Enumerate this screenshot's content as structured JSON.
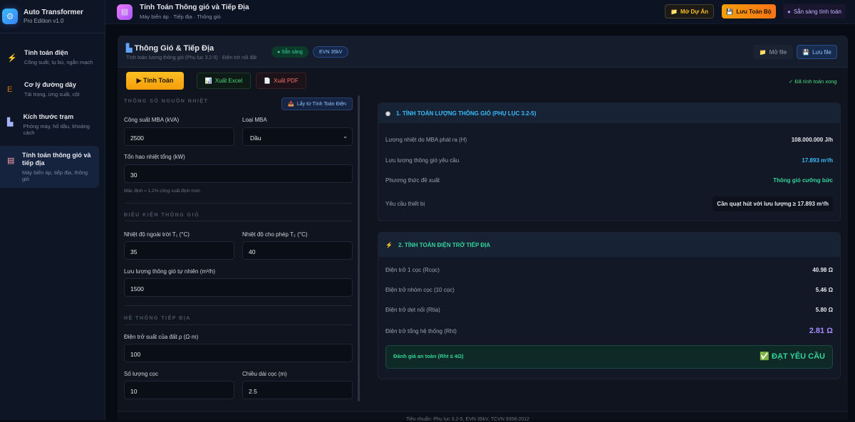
{
  "app": {
    "name": "Auto Transformer",
    "edition": "Pro Edition v1.0"
  },
  "sidebar": {
    "items": [
      {
        "title": "Tính toán điện",
        "sub": "Công suất, tụ bù, ngắn mạch",
        "icon": "lightning-icon"
      },
      {
        "title": "Cơ lý đường dây",
        "sub": "Tải trọng, ứng suất, cột",
        "icon": "tower-icon"
      },
      {
        "title": "Kích thước trạm",
        "sub": "Phòng máy, hố dầu, khoảng cách",
        "icon": "factory-icon"
      },
      {
        "title": "Tính toán thông gió và tiếp địa",
        "sub": "Máy biến áp, tiếp địa, thông gió",
        "icon": "clipboard-icon"
      }
    ]
  },
  "topbar": {
    "title": "Tính Toán Thông gió và Tiếp Địa",
    "sub": "Máy biến áp · Tiếp địa · Thông gió",
    "open_project": "Mở Dự Án",
    "save_all": "Lưu Toàn Bộ",
    "status": "Sẵn sàng tính toán"
  },
  "panel": {
    "title": "Thông Gió & Tiếp Địa",
    "sub": "Tính toán lượng thông gió (Phụ lục 3.2-5) · Điện trở nối đất",
    "badge_ready": "● Sẵn sàng",
    "badge_evn": "EVN 35kV",
    "open_file": "Mở file",
    "save_file": "Lưu file"
  },
  "toolbar": {
    "calc": "▶ Tính Toán",
    "excel": "Xuất Excel",
    "pdf": "Xuất PDF",
    "done": "✓ Đã tính toán xong"
  },
  "form": {
    "sec_heat": "THÔNG SỐ NGUỒN NHIỆT",
    "fetch": "Lấy từ Tính Toán Điện",
    "power_label": "Công suất MBA (kVA)",
    "power": "2500",
    "type_label": "Loại MBA",
    "type": "Dầu",
    "loss_label": "Tổn hao nhiệt tổng (kW)",
    "loss": "30",
    "loss_hint": "Mặc định ≈ 1.2% công suất định mức",
    "sec_vent": "ĐIỀU KIỆN THÔNG GIÓ",
    "t1_label": "Nhiệt độ ngoài trời T₁ (°C)",
    "t1": "35",
    "t2_label": "Nhiệt độ cho phép T₂ (°C)",
    "t2": "40",
    "natural_label": "Lưu lượng thông gió tự nhiên (m³/h)",
    "natural": "1500",
    "sec_ground": "HỆ THỐNG TIẾP ĐỊA",
    "rho_label": "Điện trở suất của đất ρ (Ω·m)",
    "rho": "100",
    "count_label": "Số lượng cọc",
    "count": "10",
    "length_label": "Chiều dài cọc (m)",
    "length": "2.5"
  },
  "results": {
    "vent": {
      "title": "1. TÍNH TOÁN LƯỢNG THÔNG GIÓ (PHỤ LỤC 3.2-5)",
      "rows": [
        {
          "k": "Lượng nhiệt do MBA phát ra (H)",
          "v": "108.000.000 J/h"
        },
        {
          "k": "Lưu lượng thông gió yêu cầu",
          "v": "17.893 m³/h"
        },
        {
          "k": "Phương thức đề xuất",
          "v": "Thông gió cưỡng bức"
        },
        {
          "k": "Yêu cầu thiết bị",
          "v": "Cần quạt hút với lưu lượng ≥ 17.893 m³/h"
        }
      ]
    },
    "ground": {
      "title": "2. TÍNH TOÁN ĐIỆN TRỞ TIẾP ĐỊA",
      "rows": [
        {
          "k": "Điện trở 1 cọc (Rcọc)",
          "v": "40.98 Ω"
        },
        {
          "k": "Điện trở nhóm cọc (10 cọc)",
          "v": "5.46 Ω"
        },
        {
          "k": "Điện trở dẹt nối (Rtia)",
          "v": "5.80 Ω"
        },
        {
          "k": "Điện trở tổng hệ thống (Rht)",
          "v": "2.81 Ω"
        }
      ],
      "safety_label": "Đánh giá an toàn (Rht ≤ 4Ω)",
      "safety_result": "ĐẠT YÊU CẦU"
    }
  },
  "footer": "Tiêu chuẩn: Phụ lục 3.2-5, EVN 35kV, TCVN 9358:2012"
}
